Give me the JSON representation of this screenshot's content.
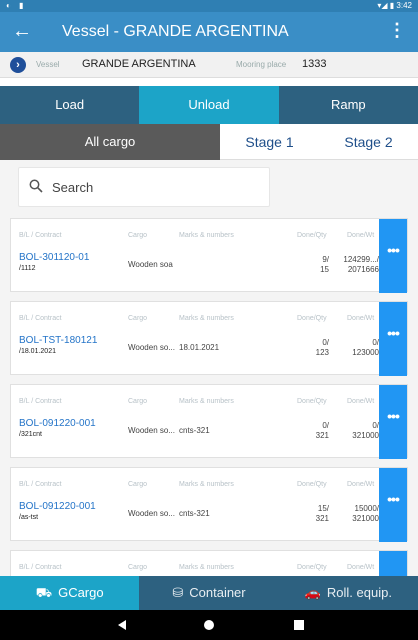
{
  "status": {
    "left": "◐ ▮",
    "right": "▾◢ ▮ 3:42"
  },
  "appbar": {
    "title": "Vessel - GRANDE ARGENTINA"
  },
  "info": {
    "vessel_label": "Vessel",
    "vessel_value": "GRANDE ARGENTINA",
    "mooring_label": "Mooring place",
    "mooring_value": "1333"
  },
  "tabs": [
    "Load",
    "Unload",
    "Ramp"
  ],
  "subtabs": {
    "all": "All cargo",
    "stage1": "Stage 1",
    "stage2": "Stage 2"
  },
  "search": {
    "placeholder": "Search"
  },
  "headers": {
    "bol": "B/L / Contract",
    "cargo": "Cargo",
    "marks": "Marks & numbers",
    "qty": "Done/Qty",
    "wt": "Done/Wt"
  },
  "cards": [
    {
      "bol": "BOL-301120-01",
      "sub": "/1112",
      "cargo": "Wooden soa",
      "marks": "",
      "q1": "9/",
      "q2": "15",
      "w1": "124299.../",
      "w2": "2071666"
    },
    {
      "bol": "BOL-TST-180121",
      "sub": "/18.01.2021",
      "cargo": "Wooden so...",
      "marks": "18.01.2021",
      "q1": "0/",
      "q2": "123",
      "w1": "0/",
      "w2": "123000"
    },
    {
      "bol": "BOL-091220-001",
      "sub": "/321cnt",
      "cargo": "Wooden so...",
      "marks": "cnts-321",
      "q1": "0/",
      "q2": "321",
      "w1": "0/",
      "w2": "321000"
    },
    {
      "bol": "BOL-091220-001",
      "sub": "/as-tst",
      "cargo": "Wooden so...",
      "marks": "cnts-321",
      "q1": "15/",
      "q2": "321",
      "w1": "15000/",
      "w2": "321000"
    },
    {
      "bol": "",
      "sub": "",
      "cargo": "",
      "marks": "",
      "q1": "",
      "q2": "",
      "w1": "",
      "w2": ""
    }
  ],
  "more_label": "•••",
  "bottom": {
    "gcargo": "GCargo",
    "container": "Container",
    "roll": "Roll. equip."
  }
}
